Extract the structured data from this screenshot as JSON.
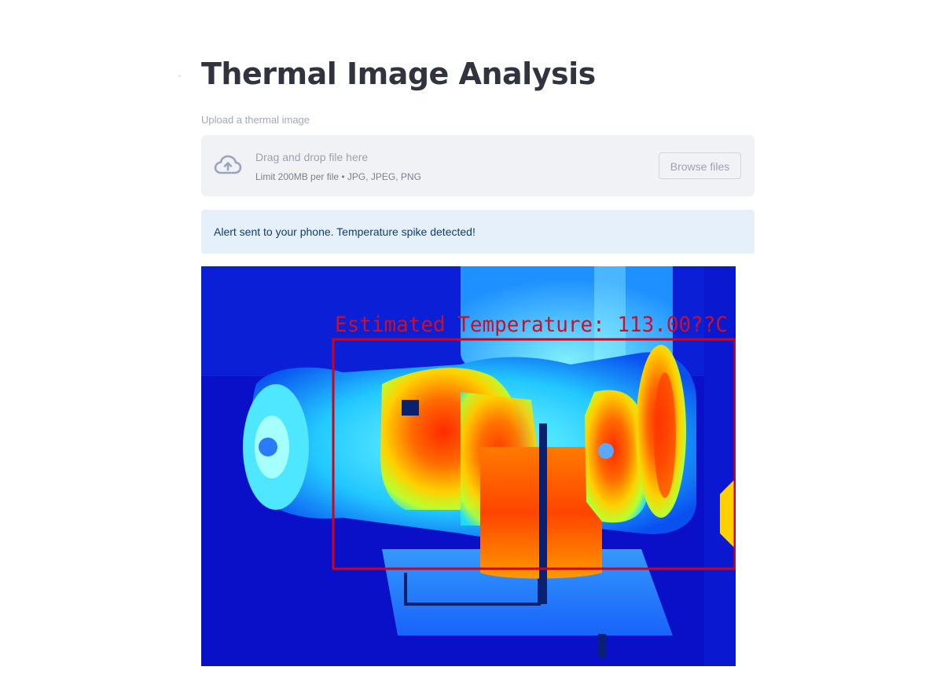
{
  "page": {
    "title": "Thermal Image Analysis"
  },
  "uploader": {
    "label": "Upload a thermal image",
    "drop_text": "Drag and drop file here",
    "limit_text": "Limit 200MB per file • JPG, JPEG, PNG",
    "browse_label": "Browse files",
    "icon": "cloud-upload-icon"
  },
  "alert": {
    "message": "Alert sent to your phone. Temperature spike detected!",
    "background": "#e6f0fb",
    "text_color": "#0f3d6e"
  },
  "result_image": {
    "overlay_text": "Estimated Temperature: 113.00??C",
    "box_color": "#d0021b"
  }
}
